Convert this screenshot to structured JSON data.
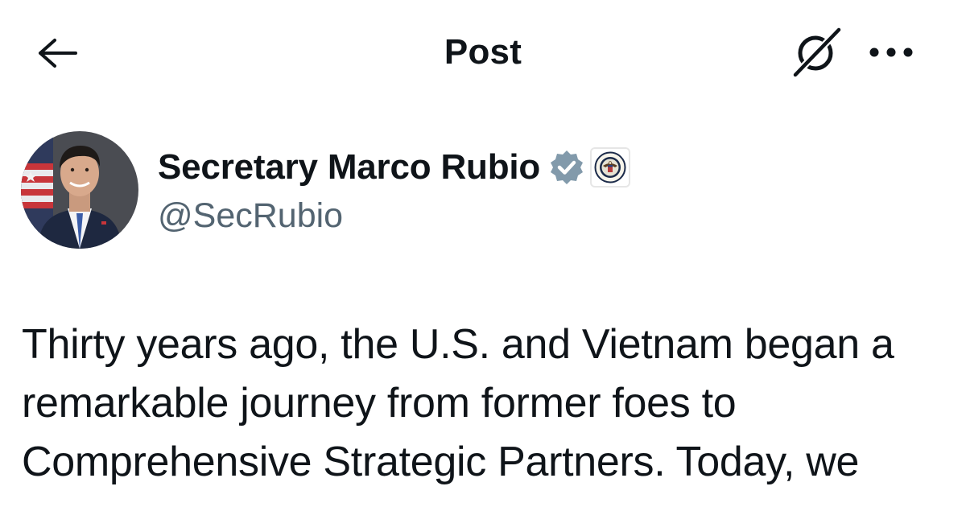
{
  "header": {
    "title": "Post",
    "back_icon": "arrow-left-icon",
    "grok_icon": "grok-icon",
    "more_icon": "more-dots-icon"
  },
  "author": {
    "name": "Secretary Marco Rubio",
    "handle": "@SecRubio",
    "verified_badge": "verified-gray-badge-icon",
    "affiliate_badge": "state-department-seal-icon",
    "badge_color": "#829aab"
  },
  "post": {
    "text": "Thirty years ago, the U.S. and Vietnam began a remarkable journey from former foes to Comprehensive Strategic Partners. Today, we"
  },
  "colors": {
    "text_primary": "#0f1419",
    "text_secondary": "#536471",
    "background": "#ffffff"
  }
}
